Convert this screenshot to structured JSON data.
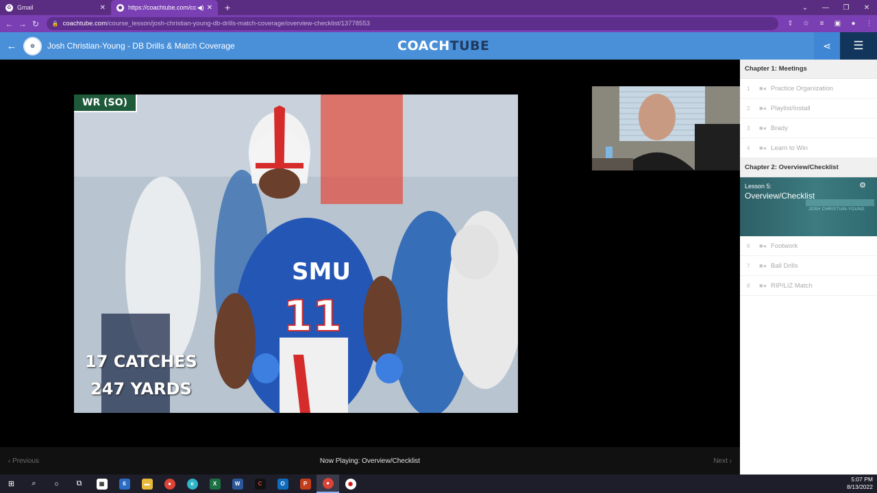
{
  "browser": {
    "tabs": [
      {
        "title": "Gmail",
        "favicon": "google-g-icon",
        "active": false
      },
      {
        "title": "https://coachtube.com/cours",
        "favicon": "coachtube-favicon",
        "active": true
      }
    ],
    "url_host": "coachtube.com",
    "url_path": "/course_lesson/josh-christian-young-db-drills-match-coverage/overview-checklist/13778553"
  },
  "header": {
    "course_title": "Josh Christian-Young - DB Drills & Match Coverage",
    "brand_part1": "COACH",
    "brand_part2": "TUBE",
    "colors": {
      "header_bg": "#4a90d9",
      "list_button_bg": "#12355c",
      "brand_dark": "#1e3a5f"
    }
  },
  "video": {
    "badge": "WR (SO)",
    "stat_line1": "17 CATCHES",
    "stat_line2": "247 YARDS",
    "jersey_text": "SMU",
    "jersey_number": "11"
  },
  "player": {
    "prev_label": "Previous",
    "now_playing": "Now Playing: Overview/Checklist",
    "next_label": "Next"
  },
  "sidebar": {
    "chapters": [
      {
        "title": "Chapter 1: Meetings",
        "lessons": [
          {
            "num": "1",
            "title": "Practice Organization"
          },
          {
            "num": "2",
            "title": "Playlist/Install"
          },
          {
            "num": "3",
            "title": "Brady"
          },
          {
            "num": "4",
            "title": "Learn to Win"
          }
        ]
      },
      {
        "title": "Chapter 2: Overview/Checklist",
        "current": {
          "label": "Lesson 5:",
          "title": "Overview/Checklist",
          "thumb_caption": "JOSH CHRISTIAN-YOUNG"
        },
        "lessons": [
          {
            "num": "6",
            "title": "Footwork"
          },
          {
            "num": "7",
            "title": "Ball Drills"
          },
          {
            "num": "8",
            "title": "RIP/LIZ Match"
          }
        ]
      }
    ]
  },
  "taskbar": {
    "time": "5:07 PM",
    "date": "8/13/2022",
    "mail_badge": "6"
  }
}
